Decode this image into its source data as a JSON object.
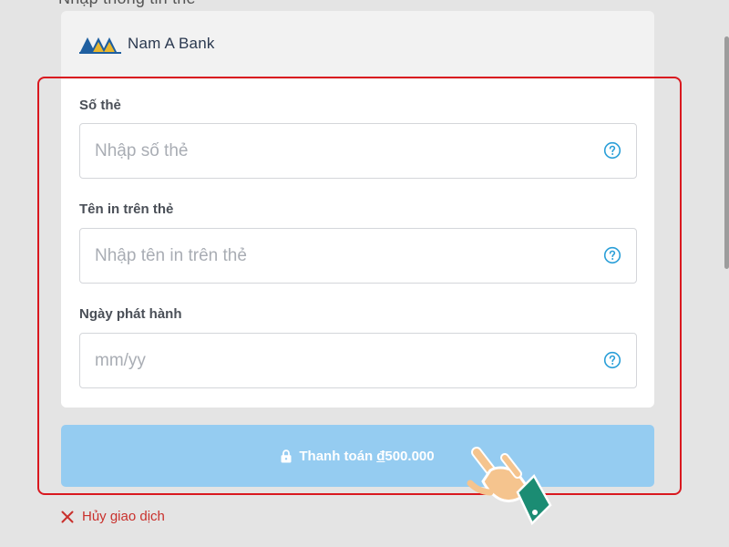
{
  "page": {
    "title_partial": "Nhập thông tin thẻ"
  },
  "bank": {
    "name": "Nam A Bank",
    "logo_icon": "nam-a-bank-logo",
    "logo_color": "#1f5fa0"
  },
  "form": {
    "fields": [
      {
        "label": "Số thẻ",
        "placeholder": "Nhập số thẻ",
        "value": "",
        "help_icon": "question-circle-icon"
      },
      {
        "label": "Tên in trên thẻ",
        "placeholder": "Nhập tên in trên thẻ",
        "value": "",
        "help_icon": "question-circle-icon"
      },
      {
        "label": "Ngày phát hành",
        "placeholder": "mm/yy",
        "value": "",
        "help_icon": "question-circle-icon"
      }
    ]
  },
  "pay_button": {
    "icon": "lock-icon",
    "label": "Thanh toán",
    "currency_symbol": "đ",
    "amount": "500.000",
    "background": "#95ccf1"
  },
  "cancel": {
    "icon": "close-x-icon",
    "label": "Hủy giao dịch",
    "color": "#c9302c"
  },
  "annotation": {
    "frame_color": "#d9181f",
    "pointer_icon": "hand-pointer-icon"
  },
  "colors": {
    "accent_blue": "#2a9fd8",
    "page_background": "#e4e4e4"
  }
}
